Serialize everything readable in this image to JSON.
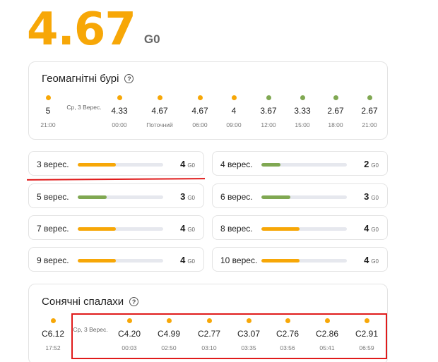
{
  "header": {
    "kp_value": "4.67",
    "kp_unit": "G0"
  },
  "colors": {
    "orange": "#f7a707",
    "green": "#80a852",
    "bar_track": "#e6e8ee",
    "annotation_red": "#e01b1b"
  },
  "geomagnetic": {
    "title": "Геомагнітні бурі",
    "help_icon": "help-circle-icon",
    "date_label": "Ср, 3 Верес.",
    "slots": [
      {
        "value": "5",
        "time": "21:00",
        "color": "orange"
      },
      {
        "value": "4.33",
        "time": "00:00",
        "color": "orange"
      },
      {
        "value": "4.67",
        "time": "Поточний",
        "color": "orange"
      },
      {
        "value": "4.67",
        "time": "06:00",
        "color": "orange"
      },
      {
        "value": "4",
        "time": "09:00",
        "color": "orange"
      },
      {
        "value": "3.67",
        "time": "12:00",
        "color": "green"
      },
      {
        "value": "3.33",
        "time": "15:00",
        "color": "green"
      },
      {
        "value": "2.67",
        "time": "18:00",
        "color": "green"
      },
      {
        "value": "2.67",
        "time": "21:00",
        "color": "green"
      }
    ]
  },
  "days": [
    {
      "label": "3 верес.",
      "value": "4",
      "unit": "G0",
      "fill": 0.45,
      "color": "orange"
    },
    {
      "label": "4 верес.",
      "value": "2",
      "unit": "G0",
      "fill": 0.22,
      "color": "green"
    },
    {
      "label": "5 верес.",
      "value": "3",
      "unit": "G0",
      "fill": 0.34,
      "color": "green"
    },
    {
      "label": "6 верес.",
      "value": "3",
      "unit": "G0",
      "fill": 0.34,
      "color": "green"
    },
    {
      "label": "7 верес.",
      "value": "4",
      "unit": "G0",
      "fill": 0.45,
      "color": "orange"
    },
    {
      "label": "8 верес.",
      "value": "4",
      "unit": "G0",
      "fill": 0.45,
      "color": "orange"
    },
    {
      "label": "9 верес.",
      "value": "4",
      "unit": "G0",
      "fill": 0.45,
      "color": "orange"
    },
    {
      "label": "10 верес.",
      "value": "4",
      "unit": "G0",
      "fill": 0.45,
      "color": "orange"
    }
  ],
  "solar_flares": {
    "title": "Сонячні спалахи",
    "help_icon": "help-circle-icon",
    "date_label": "Ср, 3 Верес.",
    "slots": [
      {
        "value": "C6.12",
        "time": "17:52",
        "color": "orange"
      },
      {
        "value": "C4.20",
        "time": "00:03",
        "color": "orange"
      },
      {
        "value": "C4.99",
        "time": "02:50",
        "color": "orange"
      },
      {
        "value": "C2.77",
        "time": "03:10",
        "color": "orange"
      },
      {
        "value": "C3.07",
        "time": "03:35",
        "color": "orange"
      },
      {
        "value": "C2.76",
        "time": "03:56",
        "color": "orange"
      },
      {
        "value": "C2.86",
        "time": "05:41",
        "color": "orange"
      },
      {
        "value": "C2.91",
        "time": "06:59",
        "color": "orange"
      }
    ]
  }
}
